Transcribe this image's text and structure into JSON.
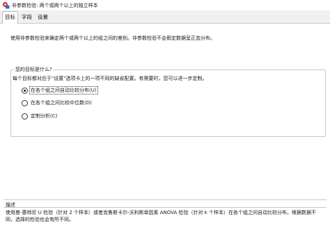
{
  "window": {
    "title": "非参数检验: 两个或两个以上的独立样本"
  },
  "tabs": [
    {
      "label": "目标"
    },
    {
      "label": "字段"
    },
    {
      "label": "设置"
    }
  ],
  "intro_text": "使用非参数检验来确定两个或两个以上的组之间的差别。非参数检验不会假定数据呈正态分布。",
  "goal_group": {
    "legend": "您的目标是什么?",
    "description": "每个目标都对应于\"设置\"选项卡上的一项不同的缺省配置。有需要时，您可以进一步定制。",
    "options": [
      {
        "label": "在各个组之间自动比较分布(U)",
        "selected": true
      },
      {
        "label": "在各个组之间比较中位数(D)",
        "selected": false
      },
      {
        "label": "定制分析(C)",
        "selected": false
      }
    ]
  },
  "description_panel": {
    "heading": "描述",
    "text": "使用曼-惠特尼 U 检验（针对 2 个样本）或者克鲁斯卡尔-沃利斯单因素 ANOVA 检验（针对 k 个样本）在各个组之间自动比较分布。根据数据不同，选择的检验也会有所不同。"
  },
  "colors": {
    "tab_bar_bg": "#f0f0f0",
    "border": "#c8c8c8",
    "text": "#1a1a1a",
    "icon_red": "#d9342b",
    "icon_blue": "#2b6cc4"
  },
  "icons": {
    "app": "spss-app-icon"
  }
}
